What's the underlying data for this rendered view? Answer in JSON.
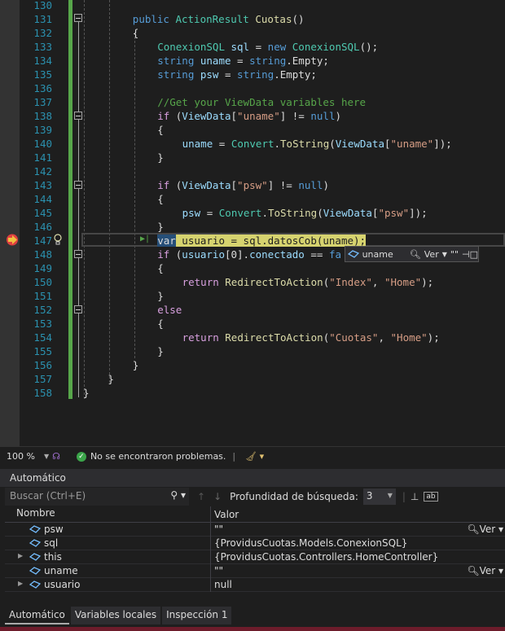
{
  "editor": {
    "lines": [
      {
        "n": "130",
        "tokens": []
      },
      {
        "n": "131",
        "tokens": [
          [
            "kw",
            "public "
          ],
          [
            "ty",
            "ActionResult "
          ],
          [
            "fn",
            "Cuotas"
          ],
          [
            "pl",
            "()"
          ]
        ]
      },
      {
        "n": "132",
        "tokens": [
          [
            "pl",
            "{"
          ]
        ]
      },
      {
        "n": "133",
        "tokens": [
          [
            "ty",
            "ConexionSQL "
          ],
          [
            "var",
            "sql "
          ],
          [
            "pl",
            "= "
          ],
          [
            "kw",
            "new "
          ],
          [
            "ty",
            "ConexionSQL"
          ],
          [
            "pl",
            "();"
          ]
        ]
      },
      {
        "n": "134",
        "tokens": [
          [
            "kw",
            "string "
          ],
          [
            "var",
            "uname "
          ],
          [
            "pl",
            "= "
          ],
          [
            "kw",
            "string"
          ],
          [
            "pl",
            "."
          ],
          [
            "pl",
            "Empty;"
          ]
        ]
      },
      {
        "n": "135",
        "tokens": [
          [
            "kw",
            "string "
          ],
          [
            "var",
            "psw "
          ],
          [
            "pl",
            "= "
          ],
          [
            "kw",
            "string"
          ],
          [
            "pl",
            "."
          ],
          [
            "pl",
            "Empty;"
          ]
        ]
      },
      {
        "n": "136",
        "tokens": []
      },
      {
        "n": "137",
        "tokens": [
          [
            "cm",
            "//Get your ViewData variables here"
          ]
        ]
      },
      {
        "n": "138",
        "tokens": [
          [
            "ctl",
            "if "
          ],
          [
            "pl",
            "("
          ],
          [
            "var",
            "ViewData"
          ],
          [
            "pl",
            "["
          ],
          [
            "st",
            "\"uname\""
          ],
          [
            "pl",
            "] != "
          ],
          [
            "kw",
            "null"
          ],
          [
            "pl",
            ")"
          ]
        ]
      },
      {
        "n": "139",
        "tokens": [
          [
            "pl",
            "{"
          ]
        ]
      },
      {
        "n": "140",
        "tokens": [
          [
            "var",
            "uname "
          ],
          [
            "pl",
            "= "
          ],
          [
            "ty",
            "Convert"
          ],
          [
            "pl",
            "."
          ],
          [
            "fn",
            "ToString"
          ],
          [
            "pl",
            "("
          ],
          [
            "var",
            "ViewData"
          ],
          [
            "pl",
            "["
          ],
          [
            "st",
            "\"uname\""
          ],
          [
            "pl",
            "]);"
          ]
        ]
      },
      {
        "n": "141",
        "tokens": [
          [
            "pl",
            "}"
          ]
        ]
      },
      {
        "n": "142",
        "tokens": []
      },
      {
        "n": "143",
        "tokens": [
          [
            "ctl",
            "if "
          ],
          [
            "pl",
            "("
          ],
          [
            "var",
            "ViewData"
          ],
          [
            "pl",
            "["
          ],
          [
            "st",
            "\"psw\""
          ],
          [
            "pl",
            "] != "
          ],
          [
            "kw",
            "null"
          ],
          [
            "pl",
            ")"
          ]
        ]
      },
      {
        "n": "144",
        "tokens": [
          [
            "pl",
            "{"
          ]
        ]
      },
      {
        "n": "145",
        "tokens": [
          [
            "var",
            "psw "
          ],
          [
            "pl",
            "= "
          ],
          [
            "ty",
            "Convert"
          ],
          [
            "pl",
            "."
          ],
          [
            "fn",
            "ToString"
          ],
          [
            "pl",
            "("
          ],
          [
            "var",
            "ViewData"
          ],
          [
            "pl",
            "["
          ],
          [
            "st",
            "\"psw\""
          ],
          [
            "pl",
            "]);"
          ]
        ]
      },
      {
        "n": "146",
        "tokens": [
          [
            "pl",
            "}"
          ]
        ]
      },
      {
        "n": "147",
        "tokens": [
          [
            "hlsel",
            "var"
          ],
          [
            "hl",
            " usuario = sql.datosCob(uname);"
          ]
        ]
      },
      {
        "n": "148",
        "tokens": [
          [
            "ctl",
            "if "
          ],
          [
            "pl",
            "("
          ],
          [
            "var",
            "usuario"
          ],
          [
            "pl",
            "[0]."
          ],
          [
            "var",
            "conectado "
          ],
          [
            "pl",
            "== "
          ],
          [
            "kw",
            "fa"
          ]
        ]
      },
      {
        "n": "149",
        "tokens": [
          [
            "pl",
            "{"
          ]
        ]
      },
      {
        "n": "150",
        "tokens": [
          [
            "ctl",
            "return "
          ],
          [
            "fn",
            "RedirectToAction"
          ],
          [
            "pl",
            "("
          ],
          [
            "st",
            "\"Index\""
          ],
          [
            "pl",
            ", "
          ],
          [
            "st",
            "\"Home\""
          ],
          [
            "pl",
            ");"
          ]
        ]
      },
      {
        "n": "151",
        "tokens": [
          [
            "pl",
            "}"
          ]
        ]
      },
      {
        "n": "152",
        "tokens": [
          [
            "ctl",
            "else"
          ]
        ]
      },
      {
        "n": "153",
        "tokens": [
          [
            "pl",
            "{"
          ]
        ]
      },
      {
        "n": "154",
        "tokens": [
          [
            "ctl",
            "return "
          ],
          [
            "fn",
            "RedirectToAction"
          ],
          [
            "pl",
            "("
          ],
          [
            "st",
            "\"Cuotas\""
          ],
          [
            "pl",
            ", "
          ],
          [
            "st",
            "\"Home\""
          ],
          [
            "pl",
            ");"
          ]
        ]
      },
      {
        "n": "155",
        "tokens": [
          [
            "pl",
            "}"
          ]
        ]
      },
      {
        "n": "156",
        "tokens": [
          [
            "pl",
            "}"
          ]
        ]
      },
      {
        "n": "157",
        "tokens": [
          [
            "pl",
            "}"
          ]
        ]
      },
      {
        "n": "158",
        "tokens": [
          [
            "pl",
            "}"
          ]
        ]
      }
    ],
    "indents": [
      0,
      8,
      8,
      12,
      12,
      12,
      0,
      12,
      12,
      12,
      16,
      12,
      0,
      12,
      12,
      16,
      12,
      12,
      12,
      12,
      16,
      12,
      12,
      12,
      16,
      12,
      8,
      4,
      0
    ]
  },
  "datatip": {
    "name": "uname",
    "view_label": "Ver",
    "value": "\"\""
  },
  "status": {
    "zoom": "100 %",
    "message": "No se encontraron problemas."
  },
  "panel": {
    "title": "Automático",
    "search_placeholder": "Buscar (Ctrl+E)",
    "depth_label": "Profundidad de búsqueda:",
    "depth_value": "3",
    "col_name": "Nombre",
    "col_value": "Valor",
    "rows": [
      {
        "name": "psw",
        "value": "\"\"",
        "expandable": false,
        "view": "Ver"
      },
      {
        "name": "sql",
        "value": "{ProvidusCuotas.Models.ConexionSQL}",
        "expandable": false,
        "view": ""
      },
      {
        "name": "this",
        "value": "{ProvidusCuotas.Controllers.HomeController}",
        "expandable": true,
        "view": ""
      },
      {
        "name": "uname",
        "value": "\"\"",
        "expandable": false,
        "view": "Ver"
      },
      {
        "name": "usuario",
        "value": "null",
        "expandable": true,
        "view": ""
      }
    ]
  },
  "tabs": [
    {
      "label": "Automático",
      "active": true
    },
    {
      "label": "Variables locales",
      "active": false
    },
    {
      "label": "Inspección 1",
      "active": false
    }
  ]
}
